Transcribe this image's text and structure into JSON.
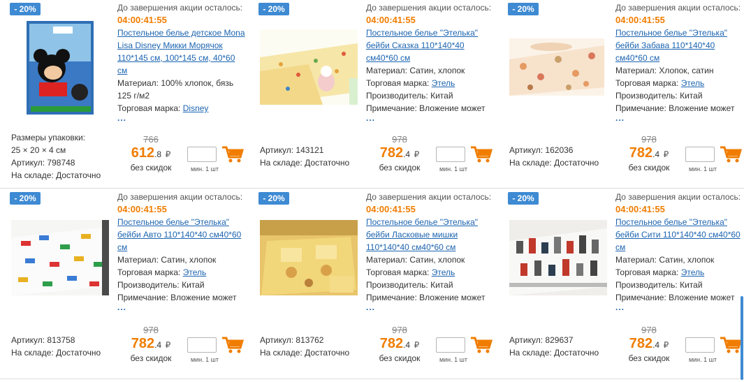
{
  "labels": {
    "promo": "До завершения акции осталось:",
    "timer": "04:00:41:55",
    "material": "Материал:",
    "brand": "Торговая марка:",
    "maker": "Производитель:",
    "note": "Примечание:",
    "sku": "Артикул:",
    "stock": "На складе:",
    "no_discount": "без скидок",
    "min_qty": "мин. 1 шт",
    "currency": "₽",
    "more": "..."
  },
  "products": [
    {
      "badge": "- 20%",
      "title": "Постельное белье детское Mona Lisa Disney Микки Морячок 110*145 см, 100*145 см, 40*60 см",
      "material": "100% хлопок, бязь 125 г/м2",
      "brand": "Disney",
      "maker": "",
      "note": "",
      "pack_label": "Размеры упаковки:",
      "pack_size": "25 × 20 × 4 см",
      "sku": "798748",
      "stock": "Достаточно",
      "old_price": "766",
      "price_int": "612",
      "price_frac": ".8"
    },
    {
      "badge": "- 20%",
      "title": "Постельное белье \"Этелька\" бейби Сказка 110*140*40 см40*60 см",
      "material": "Сатин, хлопок",
      "brand": "Этель",
      "maker": "Китай",
      "note": "Вложение может",
      "sku": "143121",
      "stock": "Достаточно",
      "old_price": "978",
      "price_int": "782",
      "price_frac": ".4"
    },
    {
      "badge": "- 20%",
      "title": "Постельное белье \"Этелька\" бейби Забава 110*140*40 см40*60 см",
      "material": "Хлопок, сатин",
      "brand": "Этель",
      "maker": "Китай",
      "note": "Вложение может",
      "sku": "162036",
      "stock": "Достаточно",
      "old_price": "978",
      "price_int": "782",
      "price_frac": ".4"
    },
    {
      "badge": "- 20%",
      "title": "Постельное белье \"Этелька\" бейби Авто 110*140*40 см40*60 см",
      "material": "Сатин, хлопок",
      "brand": "Этель",
      "maker": "Китай",
      "note": "Вложение может",
      "sku": "813758",
      "stock": "Достаточно",
      "old_price": "978",
      "price_int": "782",
      "price_frac": ".4"
    },
    {
      "badge": "- 20%",
      "title": "Постельное белье \"Этелька\" бейби Ласковые мишки 110*140*40 см40*60 см",
      "material": "Сатин, хлопок",
      "brand": "Этель",
      "maker": "Китай",
      "note": "Вложение может",
      "sku": "813762",
      "stock": "Достаточно",
      "old_price": "978",
      "price_int": "782",
      "price_frac": ".4"
    },
    {
      "badge": "- 20%",
      "title": "Постельное белье \"Этелька\" бейби Сити 110*140*40 см40*60 см",
      "material": "Сатин, хлопок",
      "brand": "Этель",
      "maker": "Китай",
      "note": "Вложение может",
      "sku": "829637",
      "stock": "Достаточно",
      "old_price": "978",
      "price_int": "782",
      "price_frac": ".4"
    }
  ],
  "colors": {
    "accent_price": "#f07d00",
    "badge_bg": "#3e8ad3",
    "link": "#1c64b0"
  }
}
